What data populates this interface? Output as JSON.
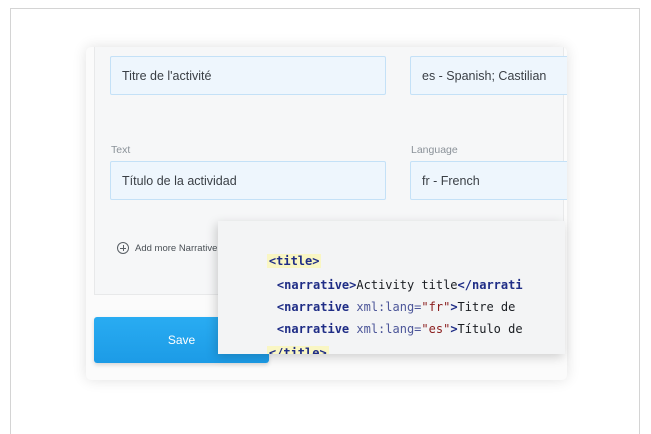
{
  "form": {
    "row1": {
      "text_value": "Titre de l'activité",
      "language_value": "es - Spanish; Castilian"
    },
    "row2": {
      "text_label": "Text",
      "language_label": "Language",
      "text_value": "Título de la actividad",
      "language_value": "fr - French"
    },
    "add_more_label": "Add more Narrative"
  },
  "actions": {
    "save_label": "Save"
  },
  "code": {
    "title_open": "<title>",
    "line1": {
      "open": "<narrative>",
      "text": "Activity title",
      "close": "</narrati"
    },
    "line2": {
      "open": "<narrative",
      "attr": " xml:lang=",
      "value": "\"fr\"",
      "close": ">",
      "text": "Titre de"
    },
    "line3": {
      "open": "<narrative",
      "attr": " xml:lang=",
      "value": "\"es\"",
      "close": ">",
      "text": "Título de"
    },
    "title_close": "</title>"
  },
  "icons": {
    "add": "plus-circle-icon"
  },
  "colors": {
    "accent": "#1c9be6",
    "field_bg": "#eef6fd",
    "highlight": "#f9f6c3",
    "code_tag": "#1f2d86"
  }
}
